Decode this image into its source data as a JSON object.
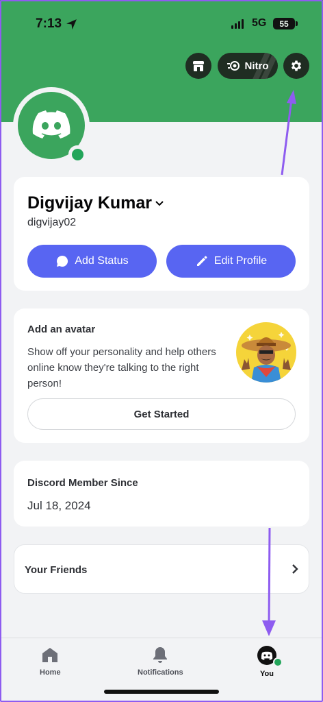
{
  "status_bar": {
    "time": "7:13",
    "network": "5G",
    "battery": "55"
  },
  "header": {
    "nitro_label": "Nitro"
  },
  "profile": {
    "display_name": "Digvijay Kumar",
    "username": "digvijay02",
    "add_status_label": "Add Status",
    "edit_profile_label": "Edit Profile"
  },
  "avatar_card": {
    "title": "Add an avatar",
    "description": "Show off your personality and help others online know they're talking to the right person!",
    "button_label": "Get Started"
  },
  "member_card": {
    "title": "Discord Member Since",
    "date": "Jul 18, 2024"
  },
  "friends_card": {
    "title": "Your Friends"
  },
  "tabs": [
    {
      "label": "Home",
      "icon": "home-icon"
    },
    {
      "label": "Notifications",
      "icon": "bell-icon"
    },
    {
      "label": "You",
      "icon": "you-avatar-icon"
    }
  ],
  "colors": {
    "banner": "#3ba55d",
    "accent": "#5865f2",
    "annotation": "#8e5cf0",
    "online": "#23a55a"
  }
}
